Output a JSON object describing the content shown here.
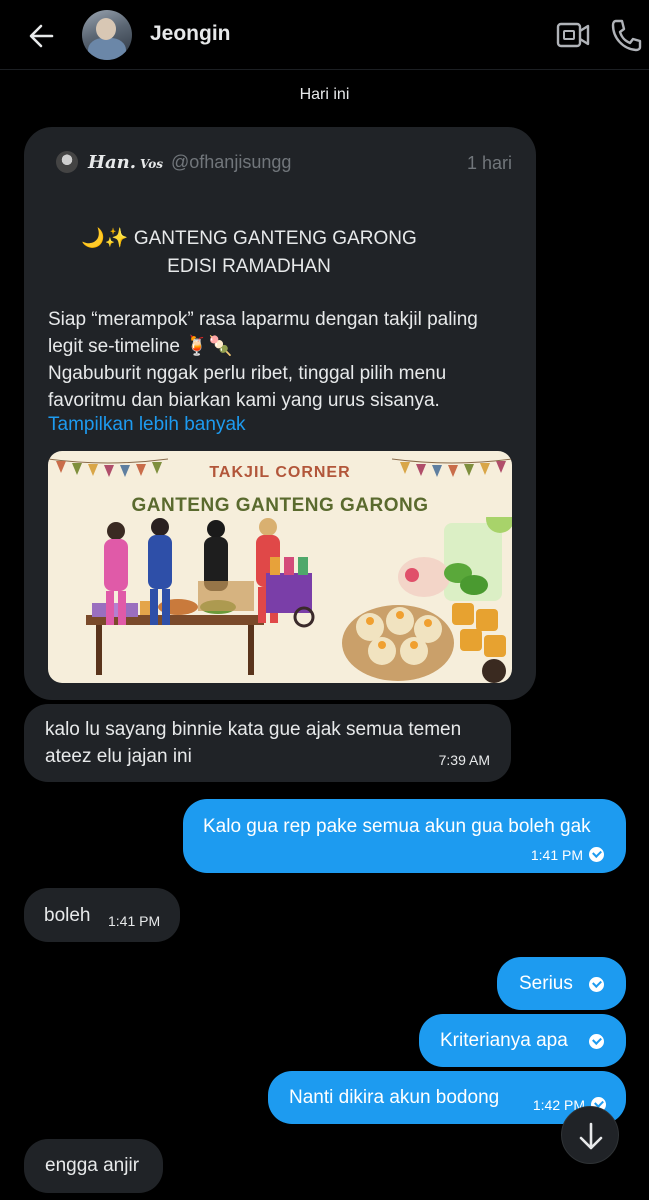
{
  "header": {
    "contact_name": "Jeongin"
  },
  "icons": {
    "back": "arrow-left-icon",
    "video": "video-call-icon",
    "phone": "phone-icon",
    "scroll": "arrow-down-icon"
  },
  "date_divider": "Hari ini",
  "quoted_post": {
    "display_name": "Han.",
    "name_suffix": "Vos",
    "handle": "@ofhanjisungg",
    "time": "1 hari",
    "title_line1": "🌙✨ GANTENG GANTENG GARONG",
    "title_line2": "EDISI RAMADHAN",
    "body_line1": "Siap “merampok” rasa laparmu dengan takjil paling",
    "body_line2": "legit se-timeline 🍹🍡",
    "body_line3": "Ngabuburit nggak perlu ribet, tinggal pilih menu",
    "body_line4": "favoritmu dan biarkan kami yang urus sisanya.",
    "show_more": "Tampilkan lebih banyak",
    "image": {
      "subtitle": "TAKJIL CORNER",
      "title": "GANTENG GANTENG GARONG"
    }
  },
  "messages": [
    {
      "direction": "in",
      "line1": "kalo lu sayang binnie kata gue ajak semua temen",
      "line2": "ateez elu jajan ini",
      "time": "7:39 AM"
    },
    {
      "direction": "out",
      "text": "Kalo gua rep pake semua akun gua boleh gak",
      "time": "1:41 PM"
    },
    {
      "direction": "in",
      "text": "boleh",
      "time": "1:41 PM"
    },
    {
      "direction": "out",
      "text": "Serius"
    },
    {
      "direction": "out",
      "text": "Kriterianya apa"
    },
    {
      "direction": "out",
      "text": "Nanti dikira akun bodong",
      "time": "1:42 PM"
    },
    {
      "direction": "in",
      "text": "engga anjir"
    }
  ],
  "colors": {
    "background": "#000000",
    "incoming_bubble": "#202327",
    "outgoing_bubble": "#1d9bf0",
    "link": "#1d9bf0",
    "muted_text": "#71767b"
  }
}
